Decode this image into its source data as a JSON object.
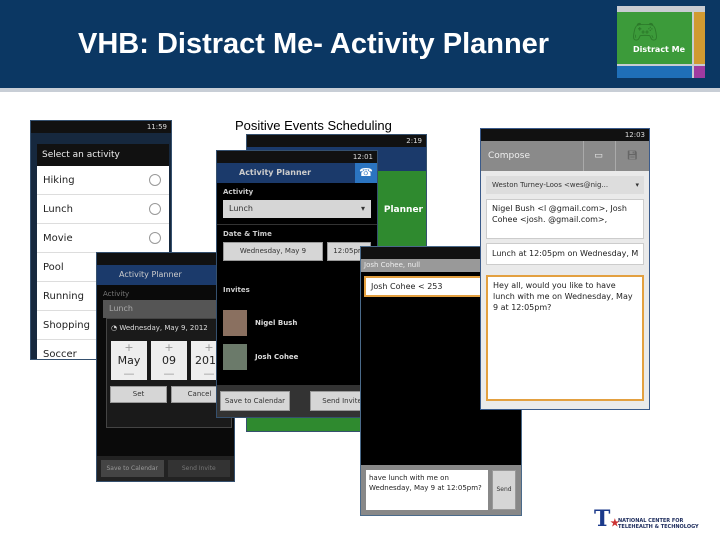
{
  "header": {
    "title": "VHB: Distract Me- Activity Planner",
    "logo_label": "Distract Me"
  },
  "caption": "Positive Events Scheduling",
  "footer_logo": "NATIONAL CENTER FOR TELEHEALTH & TECHNOLOGY",
  "screen_select": {
    "time": "11:59",
    "dialog_title": "Select an activity",
    "items": [
      "Hiking",
      "Lunch",
      "Movie",
      "Pool",
      "Running",
      "Shopping",
      "Soccer"
    ]
  },
  "screen_datepicker": {
    "app_title": "Activity Planner",
    "activity_label": "Activity",
    "activity_value": "Lunch",
    "dialog_title": "Wednesday, May 9, 2012",
    "month": "May",
    "day": "09",
    "year": "2012",
    "plus": "+",
    "minus": "—",
    "set": "Set",
    "cancel": "Cancel",
    "save": "Save to Calendar",
    "send": "Send Invite"
  },
  "screen_back": {
    "time": "2:19",
    "partial_title": "Planner"
  },
  "screen_planner": {
    "time": "12:01",
    "app_title": "Activity Planner",
    "activity_label": "Activity",
    "activity_value": "Lunch",
    "date_label": "Date & Time",
    "date_value": "Wednesday, May 9",
    "time_value": "12:05pm",
    "invites_label": "Invites",
    "invitees": [
      "Nigel Bush",
      "Josh Cohee"
    ],
    "save": "Save to Calendar",
    "send": "Send Invite"
  },
  "screen_sms": {
    "title": "Josh Cohee, null",
    "to": "Josh Cohee < 253",
    "message": "have lunch with me on Wednesday, May 9 at 12:05pm?",
    "send": "Send"
  },
  "screen_compose": {
    "time": "12:03",
    "title": "Compose",
    "from": "Weston Turney-Loos <wes@nig...",
    "to": "Nigel Bush <l            @gmail.com>, Josh Cohee <josh.          @gmail.com>,",
    "subject": "Lunch at 12:05pm on Wednesday, M",
    "body": "Hey all, would you like to have lunch with me on Wednesday, May 9 at 12:05pm?"
  }
}
